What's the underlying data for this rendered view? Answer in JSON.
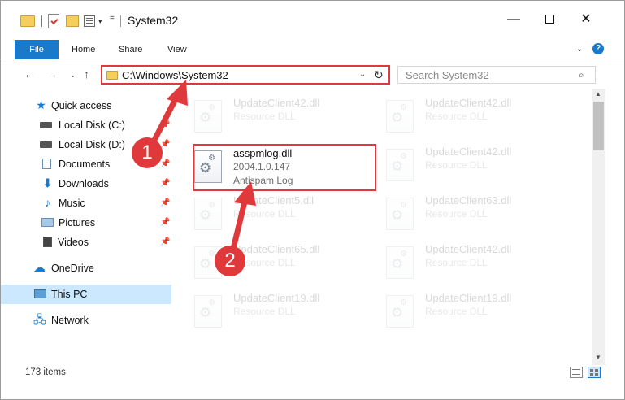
{
  "window": {
    "title": "System32",
    "controls": {
      "minimize": "—",
      "close": "✕"
    }
  },
  "quick_access_toolbar": {
    "dropdown": "▾",
    "customize": "="
  },
  "ribbon": {
    "tabs": [
      "File",
      "Home",
      "Share",
      "View"
    ],
    "expand": "⌄",
    "help": "?"
  },
  "navigation": {
    "back": "←",
    "forward": "→",
    "history": "⌄",
    "up": "↑",
    "address": "C:\\Windows\\System32",
    "address_dropdown": "⌄",
    "refresh": "↻",
    "search_placeholder": "Search System32",
    "search_icon": "⌕"
  },
  "sidebar": {
    "items": [
      {
        "label": "Quick access",
        "icon": "star-icon",
        "pinned": false
      },
      {
        "label": "Local Disk (C:)",
        "icon": "disk-icon",
        "pinned": true
      },
      {
        "label": "Local Disk (D:)",
        "icon": "disk-icon",
        "pinned": true
      },
      {
        "label": "Documents",
        "icon": "documents-icon",
        "pinned": true
      },
      {
        "label": "Downloads",
        "icon": "downloads-icon",
        "pinned": true
      },
      {
        "label": "Music",
        "icon": "music-icon",
        "pinned": true
      },
      {
        "label": "Pictures",
        "icon": "pictures-icon",
        "pinned": true
      },
      {
        "label": "Videos",
        "icon": "videos-icon",
        "pinned": true
      },
      {
        "label": "OneDrive",
        "icon": "onedrive-icon",
        "pinned": false
      },
      {
        "label": "This PC",
        "icon": "this-pc-icon",
        "pinned": false,
        "selected": true
      },
      {
        "label": "Network",
        "icon": "network-icon",
        "pinned": false
      }
    ],
    "pin_glyph": "📌"
  },
  "files": [
    {
      "name": "UpdateClient42.dll",
      "line2": "Resource DLL",
      "line3": "",
      "faded": true
    },
    {
      "name": "UpdateClient42.dll",
      "line2": "Resource DLL",
      "line3": "",
      "faded": true
    },
    {
      "name": "asspmlog.dll",
      "line2": "2004.1.0.147",
      "line3": "Antispam Log",
      "faded": false
    },
    {
      "name": "UpdateClient42.dll",
      "line2": "Resource DLL",
      "line3": "",
      "faded": true
    },
    {
      "name": "UpdateClient5.dll",
      "line2": "Resource DLL",
      "line3": "",
      "faded": true
    },
    {
      "name": "UpdateClient63.dll",
      "line2": "Resource DLL",
      "line3": "",
      "faded": true
    },
    {
      "name": "UpdateClient65.dll",
      "line2": "Resource DLL",
      "line3": "",
      "faded": true
    },
    {
      "name": "UpdateClient42.dll",
      "line2": "Resource DLL",
      "line3": "",
      "faded": true
    },
    {
      "name": "UpdateClient19.dll",
      "line2": "Resource DLL",
      "line3": "",
      "faded": true
    },
    {
      "name": "UpdateClient19.dll",
      "line2": "Resource DLL",
      "line3": "",
      "faded": true
    }
  ],
  "status": {
    "item_count": "173 items"
  },
  "scrollbar": {
    "up": "▲",
    "down": "▼"
  },
  "annotations": {
    "step1": "1",
    "step2": "2",
    "color": "#e0393b"
  }
}
